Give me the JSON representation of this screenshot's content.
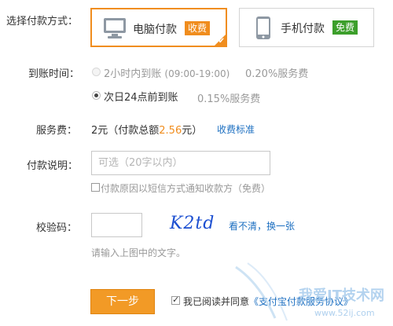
{
  "payment": {
    "label": "选择付款方式：",
    "options": [
      {
        "name": "电脑付款",
        "badge": "收费",
        "badge_color": "#f08d1e",
        "icon": "monitor-icon",
        "selected": true
      },
      {
        "name": "手机付款",
        "badge": "免费",
        "badge_color": "#3c9f2b",
        "icon": "phone-icon",
        "selected": false
      }
    ]
  },
  "arrival": {
    "label": "到账时间：",
    "options": [
      {
        "text": "2小时内到账",
        "hours": "(09:00-19:00)",
        "fee": "0.20%服务费",
        "disabled": true,
        "selected": false
      },
      {
        "text": "次日24点前到账",
        "fee": "0.15%服务费",
        "disabled": false,
        "selected": true
      }
    ]
  },
  "service_fee": {
    "label": "服务费：",
    "prefix": "2元（付款总额",
    "amount": "2.56",
    "suffix": "元）",
    "link": "收费标准"
  },
  "note": {
    "label": "付款说明：",
    "placeholder": "可选（20字以内）",
    "sms_checkbox": "付款原因以短信方式通知收款方（免费）"
  },
  "captcha": {
    "label": "校验码：",
    "image_text": "K2td",
    "refresh_link": "看不清，换一张",
    "hint": "请输入上图中的文字。"
  },
  "footer": {
    "next_button": "下一步",
    "agree_prefix": "我已阅读并同意",
    "agree_link": "《支付宝付款服务协议》"
  },
  "watermark": {
    "text": "我爱IT技术网",
    "url": "www.52ij.com"
  }
}
